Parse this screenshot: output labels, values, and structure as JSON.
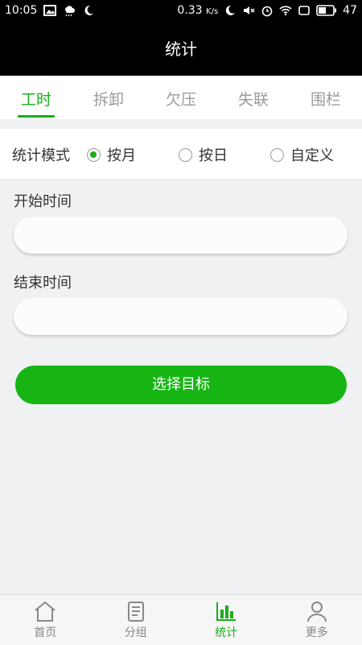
{
  "status_bar": {
    "time": "10:05",
    "speed": "0.33",
    "speed_unit": "K/s",
    "battery": "47"
  },
  "header": {
    "title": "统计"
  },
  "tabs": [
    {
      "label": "工时",
      "active": true
    },
    {
      "label": "拆卸",
      "active": false
    },
    {
      "label": "欠压",
      "active": false
    },
    {
      "label": "失联",
      "active": false
    },
    {
      "label": "围栏",
      "active": false
    }
  ],
  "mode": {
    "label": "统计模式",
    "options": [
      {
        "label": "按月",
        "checked": true
      },
      {
        "label": "按日",
        "checked": false
      },
      {
        "label": "自定义",
        "checked": false
      }
    ]
  },
  "start": {
    "label": "开始时间",
    "value": ""
  },
  "end": {
    "label": "结束时间",
    "value": ""
  },
  "action": {
    "label": "选择目标"
  },
  "nav": [
    {
      "label": "首页",
      "icon": "home-icon",
      "active": false
    },
    {
      "label": "分组",
      "icon": "group-icon",
      "active": false
    },
    {
      "label": "统计",
      "icon": "chart-icon",
      "active": true
    },
    {
      "label": "更多",
      "icon": "person-icon",
      "active": false
    }
  ],
  "colors": {
    "accent": "#1aad19",
    "button": "#16b514",
    "header": "#000000"
  }
}
